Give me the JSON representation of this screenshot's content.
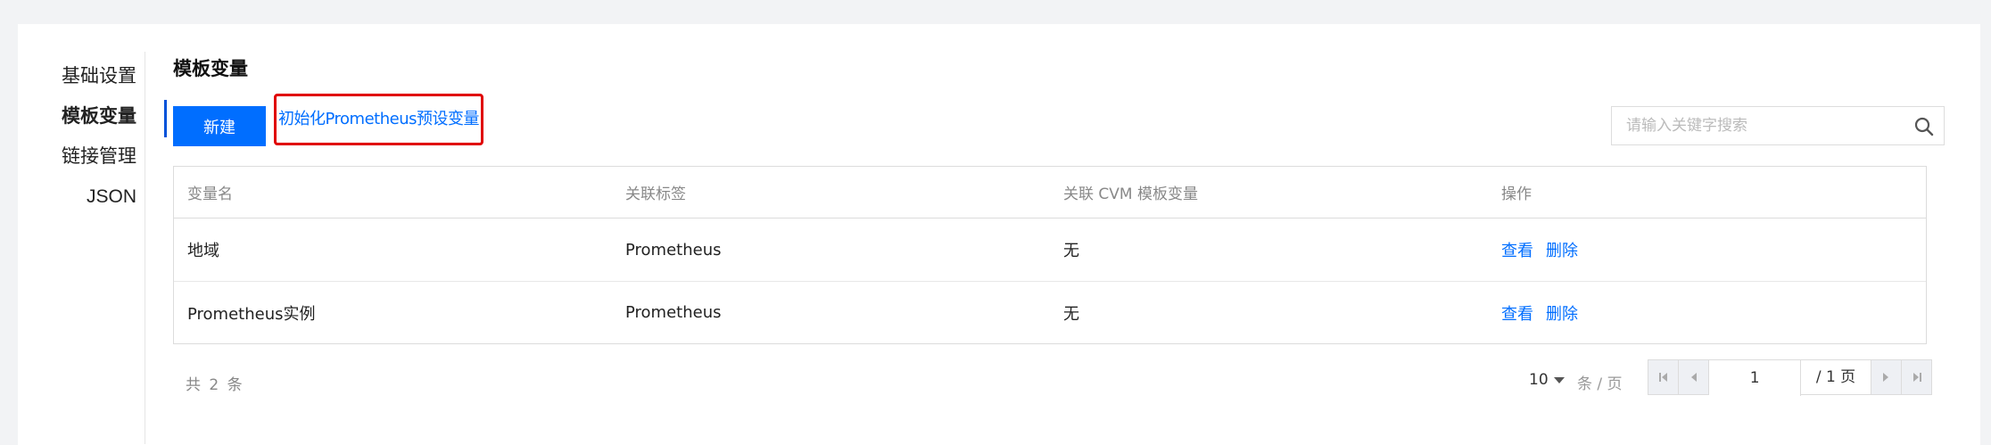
{
  "sidenav": {
    "items": [
      {
        "label": "基础设置"
      },
      {
        "label": "模板变量"
      },
      {
        "label": "链接管理"
      },
      {
        "label": "JSON"
      }
    ]
  },
  "page": {
    "title": "模板变量",
    "new_button": "新建",
    "init_link": "初始化Prometheus预设变量",
    "search_placeholder": "请输入关键字搜索"
  },
  "table": {
    "columns": [
      "变量名",
      "关联标签",
      "关联 CVM 模板变量",
      "操作"
    ],
    "rows": [
      {
        "name": "地域",
        "tag": "Prometheus",
        "cvm": "无",
        "actions": [
          "查看",
          "删除"
        ]
      },
      {
        "name": "Prometheus实例",
        "tag": "Prometheus",
        "cvm": "无",
        "actions": [
          "查看",
          "删除"
        ]
      }
    ]
  },
  "pagination": {
    "total": "共 2 条",
    "page_size": "10",
    "per_page": "条 / 页",
    "current_page": "1",
    "total_pages": "/ 1 页"
  },
  "colors": {
    "primary": "#006eff",
    "highlight_border": "#e00000"
  }
}
